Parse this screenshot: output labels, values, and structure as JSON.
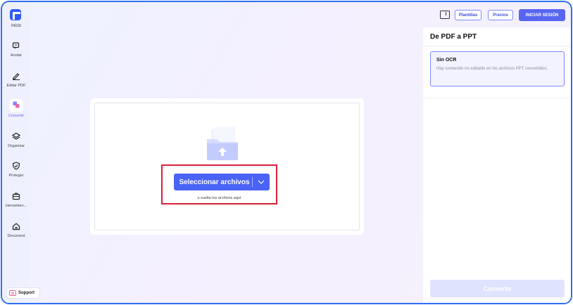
{
  "sidebar": {
    "logo_label": "Inicio",
    "items": [
      {
        "label": "Anotar",
        "icon": "chat-edit-icon"
      },
      {
        "label": "Editar PDF",
        "icon": "pen-icon"
      },
      {
        "label": "Convertir",
        "icon": "convert-icon"
      },
      {
        "label": "Organizar",
        "icon": "layers-icon"
      },
      {
        "label": "Proteger",
        "icon": "shield-icon"
      },
      {
        "label": "Herramien...",
        "icon": "toolbox-icon"
      },
      {
        "label": "Document",
        "icon": "home-icon"
      }
    ],
    "support_label": "Support"
  },
  "topbar": {
    "templates_label": "Plantillas",
    "pricing_label": "Precios",
    "login_label": "INICIAR SESIÓN"
  },
  "upload": {
    "select_label": "Seleccionar archivos",
    "drop_hint": "o suelta los archivos aquí"
  },
  "panel": {
    "title": "De PDF a PPT",
    "ocr_title": "Sin OCR",
    "ocr_desc": "Hay contenido no editable en los archivos PPT convertidos.",
    "convert_label": "Convertir"
  },
  "colors": {
    "accent": "#4a63f6",
    "highlight": "#d9213a",
    "active_nav": "#7b5cff"
  }
}
